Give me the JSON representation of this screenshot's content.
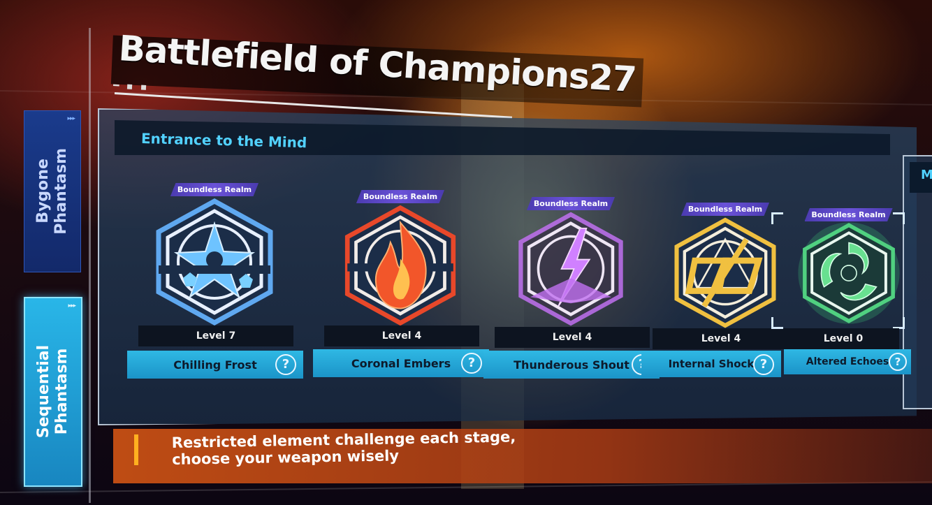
{
  "title": "Battlefield of Champions27",
  "side_tabs": [
    {
      "label": "Bygone\nPhantasm",
      "active": false
    },
    {
      "label": "Sequential\nPhantasm",
      "active": true
    }
  ],
  "panel": {
    "title": "Entrance to the Mind",
    "next_title": "M"
  },
  "cards": [
    {
      "realm": "Boundless Realm",
      "level": "Level 7",
      "name": "Chilling Frost",
      "element": "frost",
      "color": "#5fb0f0",
      "icon": "snowflake-icon"
    },
    {
      "realm": "Boundless Realm",
      "level": "Level 4",
      "name": "Coronal Embers",
      "element": "fire",
      "color": "#f05a2a",
      "icon": "flame-icon"
    },
    {
      "realm": "Boundless Realm",
      "level": "Level 4",
      "name": "Thunderous Shout",
      "element": "thunder",
      "color": "#c070f0",
      "icon": "lightning-icon"
    },
    {
      "realm": "Boundless Realm",
      "level": "Level 4",
      "name": "Internal Shock",
      "element": "physical",
      "color": "#f0c040",
      "icon": "shield-sigil-icon"
    },
    {
      "realm": "Boundless Realm",
      "level": "Level 0",
      "name": "Altered Echoes",
      "element": "wind",
      "color": "#50d080",
      "icon": "wind-swirl-icon",
      "selected": true
    }
  ],
  "help_glyph": "?",
  "banner": {
    "text": "Restricted element challenge each stage,\nchoose your weapon wisely"
  }
}
